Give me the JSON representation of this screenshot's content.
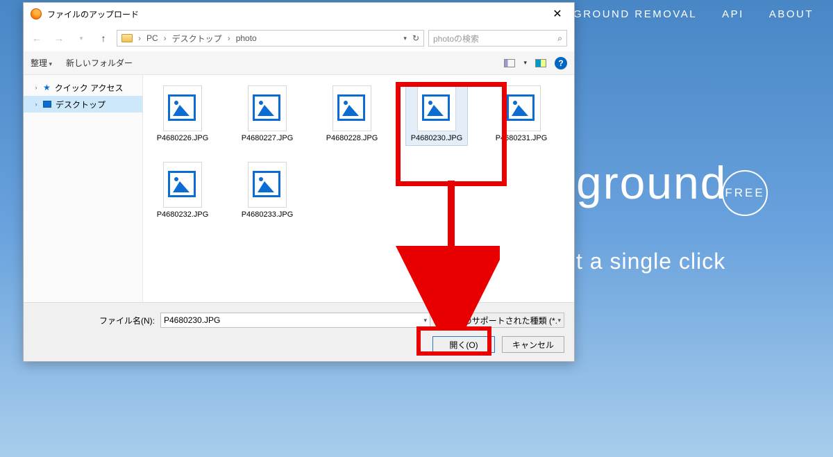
{
  "website": {
    "nav": {
      "item1": "GROUND REMOVAL",
      "item2": "API",
      "item3": "ABOUT"
    },
    "title_fragment": "ground",
    "free_badge": "FREE",
    "subtitle_fragment": "t a single click"
  },
  "dialog": {
    "title": "ファイルのアップロード",
    "path": {
      "seg1": "PC",
      "seg2": "デスクトップ",
      "seg3": "photo"
    },
    "search_placeholder": "photoの検索",
    "toolbar": {
      "organize": "整理",
      "newfolder": "新しいフォルダー"
    },
    "sidebar": {
      "quick_access": "クイック アクセス",
      "desktop": "デスクトップ"
    },
    "files": [
      {
        "name": "P4680226.JPG"
      },
      {
        "name": "P4680227.JPG"
      },
      {
        "name": "P4680228.JPG"
      },
      {
        "name": "P4680230.JPG"
      },
      {
        "name": "P4680231.JPG"
      },
      {
        "name": "P4680232.JPG"
      },
      {
        "name": "P4680233.JPG"
      }
    ],
    "selected_file": "P4680230.JPG",
    "footer": {
      "filename_label": "ファイル名(N):",
      "filetype": "すべてのサポートされた種類 (*.jpg;*",
      "open": "開く(O)",
      "cancel": "キャンセル"
    }
  }
}
